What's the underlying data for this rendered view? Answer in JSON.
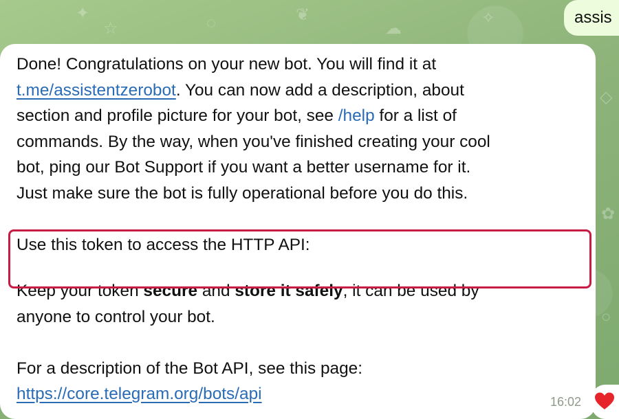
{
  "outgoing_message": {
    "text": "assis"
  },
  "incoming_message": {
    "paragraph1": {
      "line1": "Done! Congratulations on your new bot. You will find it at",
      "bot_link": "t.me/assistentzerobot",
      "line2_rest": ". You can now add a description, about",
      "line3_start": "section and profile picture for your bot, see ",
      "help_command": "/help",
      "line3_end": " for a list of",
      "line4": "commands. By the way, when you've finished creating your cool",
      "line5": "bot, ping our Bot Support if you want a better username for it.",
      "line6": "Just make sure the bot is fully operational before you do this."
    },
    "token_intro": "Use this token to access the HTTP API:",
    "paragraph2": {
      "start": "Keep your token ",
      "bold1": "secure",
      "middle": " and ",
      "bold2": "store it safely",
      "end": ", it can be used by",
      "line2": "anyone to control your bot."
    },
    "paragraph3": {
      "line1": "For a description of the Bot API, see this page:",
      "api_link": "https://core.telegram.org/bots/api"
    },
    "timestamp": "16:02",
    "reaction_icon": "heart-icon"
  },
  "colors": {
    "link": "#2a6bb5",
    "highlight_box": "#c71d45",
    "outgoing_bubble": "#eefcde",
    "reaction_heart": "#e5252a"
  }
}
